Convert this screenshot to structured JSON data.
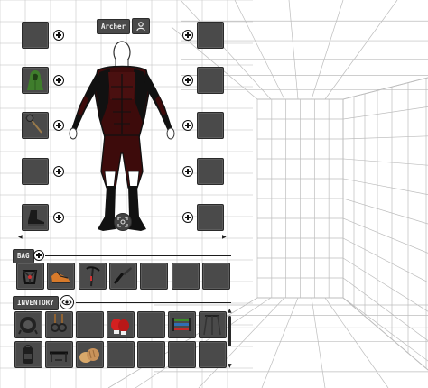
{
  "character": {
    "name": "Archer",
    "profile_icon": "person-icon",
    "focus_icon": "focus-target-icon"
  },
  "equipment": {
    "left_slots": [
      {
        "slot": "head",
        "item": null
      },
      {
        "slot": "cloak",
        "item": "green-hooded-cloak-icon"
      },
      {
        "slot": "weapon",
        "item": "spiked-mace-icon"
      },
      {
        "slot": "hands",
        "item": null
      },
      {
        "slot": "feet",
        "item": "leather-boot-icon"
      }
    ],
    "right_slots": [
      {
        "slot": "neck",
        "item": null
      },
      {
        "slot": "chest",
        "item": null
      },
      {
        "slot": "offhand",
        "item": null
      },
      {
        "slot": "ring",
        "item": null
      },
      {
        "slot": "trinket",
        "item": null
      }
    ],
    "add_icon": "plus-circle-icon"
  },
  "bag": {
    "label": "BAG",
    "add_icon": "plus-circle-icon",
    "slots": [
      "harness-icon",
      "climbing-shoe-icon",
      "ice-axe-icon",
      "knife-icon",
      null,
      null,
      null
    ]
  },
  "inventory": {
    "label": "INVENTORY",
    "visibility_icon": "eye-icon",
    "rows": [
      [
        "mask-helmet-icon",
        "rings-icon",
        null,
        "boxing-gloves-icon",
        null,
        "resistance-bands-icon",
        "tripod-icon"
      ],
      [
        "backpack-icon",
        "bench-icon",
        "bread-icon",
        null,
        null,
        null,
        null
      ]
    ]
  },
  "colors": {
    "slot_bg": "#4a4a4a",
    "suit_red": "#3d0b0b",
    "suit_black": "#111111",
    "bands": "#3c8a2a"
  }
}
